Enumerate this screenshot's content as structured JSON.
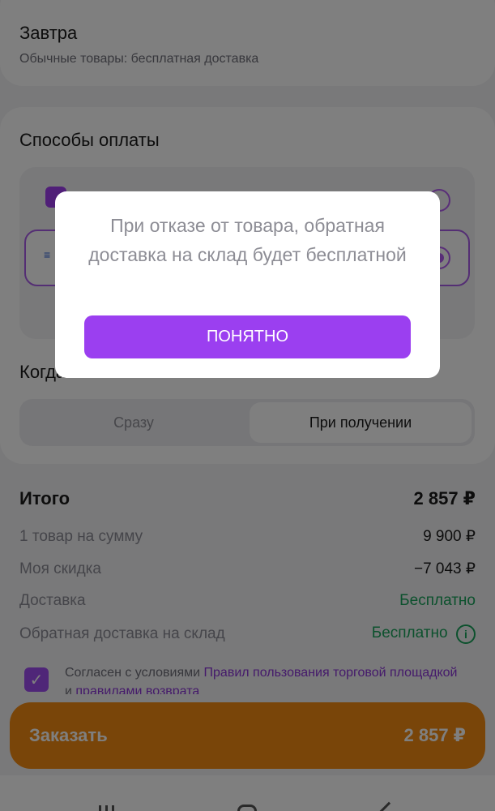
{
  "delivery": {
    "title": "Завтра",
    "subtitle": "Обычные товары: бесплатная доставка"
  },
  "payment": {
    "title": "Способы оплаты",
    "when_title": "Когда оплатить",
    "options": [
      {
        "icon": "wallet-icon",
        "selected": false
      },
      {
        "icon": "card-icon",
        "icon_text": "≡",
        "selected": true
      }
    ],
    "segments": [
      {
        "label": "Сразу",
        "selected": false
      },
      {
        "label": "При получении",
        "selected": true
      }
    ]
  },
  "summary": {
    "total_label": "Итого",
    "total_value": "2 857 ₽",
    "items_label": "1 товар на сумму",
    "items_value": "9 900 ₽",
    "discount_label": "Моя скидка",
    "discount_value": "−7 043 ₽",
    "delivery_label": "Доставка",
    "delivery_value": "Бесплатно",
    "return_label": "Обратная доставка на склад",
    "return_value": "Бесплатно",
    "info_glyph": "i"
  },
  "terms": {
    "checked": true,
    "check_glyph": "✓",
    "prefix": "Согласен с условиями ",
    "link1": "Правил пользования торговой площадкой",
    "middle": " и ",
    "link2": "правилами возврата"
  },
  "order": {
    "label": "Заказать",
    "price": "2 857 ₽"
  },
  "modal": {
    "text": "При отказе от товара, обратная доставка на склад будет бесплатной",
    "button": "ПОНЯТНО"
  },
  "colors": {
    "accent": "#9b3ff0",
    "order_button": "#f28a12",
    "positive": "#19a35b"
  }
}
